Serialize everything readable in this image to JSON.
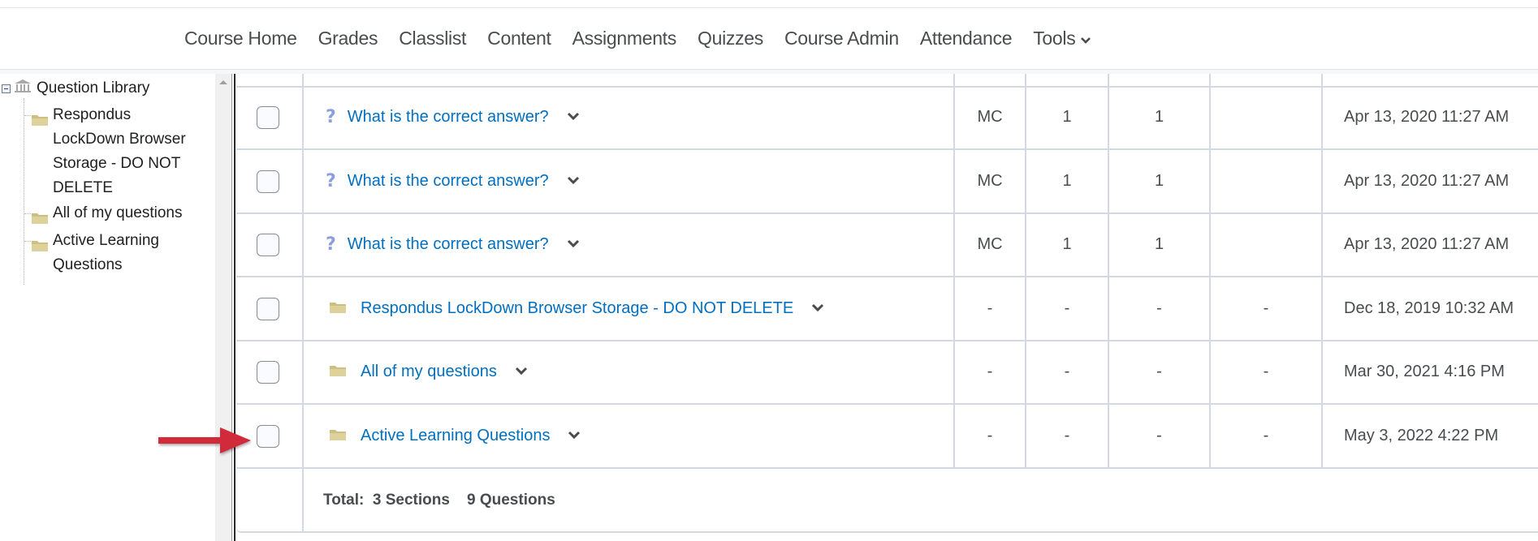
{
  "nav": {
    "items": [
      {
        "label": "Course Home"
      },
      {
        "label": "Grades"
      },
      {
        "label": "Classlist"
      },
      {
        "label": "Content"
      },
      {
        "label": "Assignments"
      },
      {
        "label": "Quizzes"
      },
      {
        "label": "Course Admin"
      },
      {
        "label": "Attendance"
      },
      {
        "label": "Tools",
        "has_dropdown": true
      }
    ]
  },
  "sidebar": {
    "root_label": "Question Library",
    "root_icon": "bank-icon",
    "items": [
      {
        "label": "Respondus LockDown Browser Storage - DO NOT DELETE",
        "icon": "folder-icon"
      },
      {
        "label": "All of my questions",
        "icon": "folder-icon"
      },
      {
        "label": "Active Learning Questions",
        "icon": "folder-icon"
      }
    ]
  },
  "table": {
    "rows": [
      {
        "type": "question",
        "icon": "question-icon",
        "icon_glyph": "?",
        "name": "What is the correct answer?",
        "qtype": "MC",
        "col3": "1",
        "col4": "1",
        "col5": "",
        "date": "Apr 13, 2020 11:27 AM",
        "checked": false
      },
      {
        "type": "question",
        "icon": "question-icon",
        "icon_glyph": "?",
        "name": "What is the correct answer?",
        "qtype": "MC",
        "col3": "1",
        "col4": "1",
        "col5": "",
        "date": "Apr 13, 2020 11:27 AM",
        "checked": false
      },
      {
        "type": "question",
        "icon": "question-icon",
        "icon_glyph": "?",
        "name": "What is the correct answer?",
        "qtype": "MC",
        "col3": "1",
        "col4": "1",
        "col5": "",
        "date": "Apr 13, 2020 11:27 AM",
        "checked": false
      },
      {
        "type": "section",
        "icon": "folder-icon",
        "name": "Respondus LockDown Browser Storage - DO NOT DELETE",
        "qtype": "-",
        "col3": "-",
        "col4": "-",
        "col5": "-",
        "date": "Dec 18, 2019 10:32 AM",
        "checked": false
      },
      {
        "type": "section",
        "icon": "folder-icon",
        "name": "All of my questions",
        "qtype": "-",
        "col3": "-",
        "col4": "-",
        "col5": "-",
        "date": "Mar 30, 2021 4:16 PM",
        "checked": false
      },
      {
        "type": "section",
        "icon": "folder-icon",
        "name": "Active Learning Questions",
        "qtype": "-",
        "col3": "-",
        "col4": "-",
        "col5": "-",
        "date": "May 3, 2022 4:22 PM",
        "checked": false
      }
    ],
    "total_label": "Total:  3 Sections    9 Questions"
  },
  "annotation": {
    "arrow_color": "#d0293a",
    "points_to": "Active Learning Questions checkbox"
  },
  "colors": {
    "link": "#006fbf",
    "text": "#494c4e",
    "grid": "#d3d9e3",
    "folder": "#c9b97a",
    "question_icon": "#8b9fe0"
  }
}
